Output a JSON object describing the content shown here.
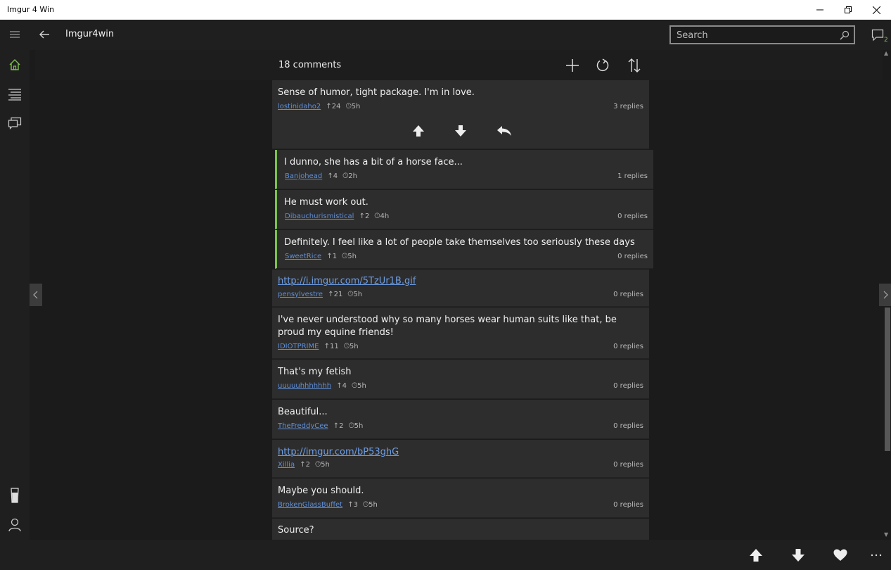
{
  "window": {
    "title": "Imgur 4 Win"
  },
  "header": {
    "app_title": "Imgur4win",
    "search_placeholder": "Search",
    "notification_count": "2"
  },
  "colors": {
    "accent": "#7cc04a",
    "link": "#5f8fd8"
  },
  "sidebar": {
    "items": [
      {
        "icon": "home-icon"
      },
      {
        "icon": "list-icon"
      },
      {
        "icon": "messages-icon"
      }
    ],
    "bottom_items": [
      {
        "icon": "beer-glass-icon"
      },
      {
        "icon": "user-icon"
      },
      {
        "icon": "settings-icon"
      }
    ]
  },
  "comments_bar": {
    "count_label": "18  comments"
  },
  "comments": [
    {
      "text": "Sense of humor, tight package. I'm in love.",
      "user": "lostinidaho2",
      "points": "24",
      "age": "5h",
      "replies": "3  replies"
    },
    {
      "text": "I dunno, she has a bit of a horse face...",
      "user": "Banjohead",
      "points": "4",
      "age": "2h",
      "replies": "1  replies"
    },
    {
      "text": "He must work out.",
      "user": "Dibauchurismistical",
      "points": "2",
      "age": "4h",
      "replies": "0  replies"
    },
    {
      "text": "Definitely. I feel like a lot of people take themselves too seriously these days",
      "user": "SweetRice",
      "points": "1",
      "age": "5h",
      "replies": "0  replies"
    },
    {
      "text": "http://i.imgur.com/5TzUr1B.gif",
      "user": "pensylvestre",
      "points": "21",
      "age": "5h",
      "replies": "0  replies"
    },
    {
      "text": "I've never understood why so many horses wear human suits like that, be proud my equine friends!",
      "user": "IDIOTPRIME",
      "points": "11",
      "age": "5h",
      "replies": "0  replies"
    },
    {
      "text": "That's my fetish",
      "user": "uuuuuhhhhhhh",
      "points": "4",
      "age": "5h",
      "replies": "0  replies"
    },
    {
      "text": "Beautiful...",
      "user": "TheFreddyCee",
      "points": "2",
      "age": "5h",
      "replies": "0  replies"
    },
    {
      "text": "http://imgur.com/bP53ghG",
      "user": "Xillia",
      "points": "2",
      "age": "5h",
      "replies": "0  replies"
    },
    {
      "text": "Maybe you should.",
      "user": "BrokenGlassBuffet",
      "points": "3",
      "age": "5h",
      "replies": "0  replies"
    },
    {
      "text": "Source?"
    }
  ]
}
